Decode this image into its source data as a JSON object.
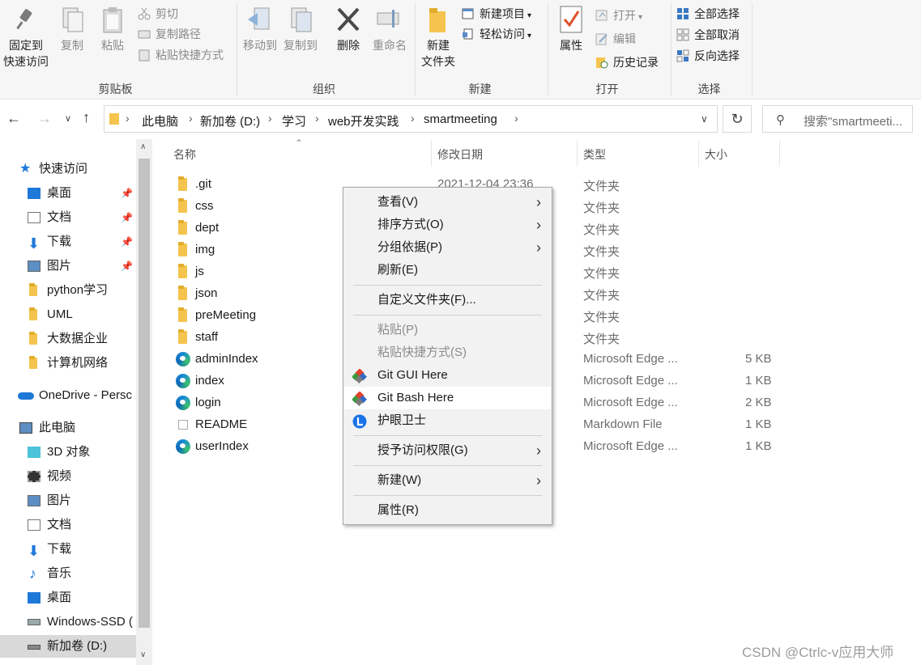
{
  "ribbon": {
    "clipboard": {
      "title": "剪贴板",
      "pin_label_1": "固定到",
      "pin_label_2": "快速访问",
      "copy": "复制",
      "paste": "粘贴",
      "cut": "剪切",
      "copy_path": "复制路径",
      "paste_shortcut": "粘贴快捷方式"
    },
    "organize": {
      "title": "组织",
      "move_to": "移动到",
      "copy_to": "复制到",
      "delete": "删除",
      "rename": "重命名"
    },
    "new": {
      "title": "新建",
      "new_folder_1": "新建",
      "new_folder_2": "文件夹",
      "new_item": "新建项目",
      "easy_access": "轻松访问"
    },
    "open": {
      "title": "打开",
      "properties": "属性",
      "open": "打开",
      "edit": "编辑",
      "history": "历史记录"
    },
    "select": {
      "title": "选择",
      "select_all": "全部选择",
      "select_none": "全部取消",
      "invert": "反向选择"
    }
  },
  "address": {
    "crumbs": [
      "此电脑",
      "新加卷 (D:)",
      "学习",
      "web开发实践",
      "smartmeeting"
    ],
    "search_placeholder": "搜索\"smartmeeti..."
  },
  "nav": {
    "quick_access": "快速访问",
    "items": [
      "桌面",
      "文档",
      "下载",
      "图片",
      "python学习",
      "UML",
      "大数据企业",
      "计算机网络"
    ],
    "onedrive": "OneDrive - Persc",
    "this_pc": "此电脑",
    "pc_items": [
      "3D 对象",
      "视频",
      "图片",
      "文档",
      "下载",
      "音乐",
      "桌面",
      "Windows-SSD (",
      "新加卷 (D:)"
    ]
  },
  "columns": {
    "name": "名称",
    "modified": "修改日期",
    "type": "类型",
    "size": "大小"
  },
  "files": [
    {
      "name": ".git",
      "modified": "2021-12-04 23:36",
      "type": "文件夹",
      "size": "",
      "icon": "folder"
    },
    {
      "name": "css",
      "type": "文件夹",
      "size": "",
      "icon": "folder"
    },
    {
      "name": "dept",
      "type": "文件夹",
      "size": "",
      "icon": "folder"
    },
    {
      "name": "img",
      "type": "文件夹",
      "size": "",
      "icon": "folder"
    },
    {
      "name": "js",
      "type": "文件夹",
      "size": "",
      "icon": "folder"
    },
    {
      "name": "json",
      "type": "文件夹",
      "size": "",
      "icon": "folder"
    },
    {
      "name": "preMeeting",
      "type": "文件夹",
      "size": "",
      "icon": "folder"
    },
    {
      "name": "staff",
      "type": "文件夹",
      "size": "",
      "icon": "folder"
    },
    {
      "name": "adminIndex",
      "type": "Microsoft Edge ...",
      "size": "5 KB",
      "icon": "edge"
    },
    {
      "name": "index",
      "type": "Microsoft Edge ...",
      "size": "1 KB",
      "icon": "edge"
    },
    {
      "name": "login",
      "type": "Microsoft Edge ...",
      "size": "2 KB",
      "icon": "edge"
    },
    {
      "name": "README",
      "type": "Markdown File",
      "size": "1 KB",
      "icon": "markdown"
    },
    {
      "name": "userIndex",
      "type": "Microsoft Edge ...",
      "size": "1 KB",
      "icon": "edge"
    }
  ],
  "context_menu": {
    "view": "查看(V)",
    "sort": "排序方式(O)",
    "group": "分组依据(P)",
    "refresh": "刷新(E)",
    "customize": "自定义文件夹(F)...",
    "paste": "粘贴(P)",
    "paste_shortcut": "粘贴快捷方式(S)",
    "git_gui": "Git GUI Here",
    "git_bash": "Git Bash Here",
    "eye_guard": "护眼卫士",
    "grant_access": "授予访问权限(G)",
    "new": "新建(W)",
    "properties": "属性(R)"
  },
  "watermark": "CSDN @Ctrlc-v应用大师",
  "colors": {
    "folder": "#f4c44e",
    "ribbon_bg": "#f6f6f6",
    "menu_bg": "#f2f2f2",
    "accent": "#1a73e8"
  }
}
